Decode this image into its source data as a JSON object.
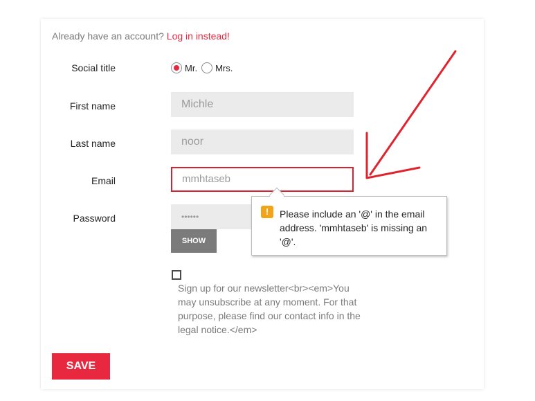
{
  "header": {
    "already_text": "Already have an account?",
    "login_link": "Log in instead!"
  },
  "form": {
    "social_title": {
      "label": "Social title",
      "options": [
        "Mr.",
        "Mrs."
      ],
      "selected": "Mr."
    },
    "first_name": {
      "label": "First name",
      "value": "Michle"
    },
    "last_name": {
      "label": "Last name",
      "value": "noor"
    },
    "email": {
      "label": "Email",
      "value": "mmhtaseb"
    },
    "password": {
      "label": "Password",
      "value": "••••••",
      "show_label": "SHOW"
    },
    "newsletter": {
      "checked": false,
      "text": "Sign up for our newsletter<br><em>You may unsubscribe at any moment. For that purpose, please find our contact info in the legal notice.</em>"
    },
    "save_label": "SAVE"
  },
  "validation_tooltip": {
    "icon": "warning-icon",
    "icon_glyph": "!",
    "message": "Please include an '@' in the email address. 'mmhtaseb' is missing an '@'."
  },
  "colors": {
    "accent": "#e8283f",
    "annotation_red": "#d7222f",
    "warning": "#f1a31a",
    "input_bg": "#ebebeb",
    "show_button_bg": "#7b7b7b"
  }
}
